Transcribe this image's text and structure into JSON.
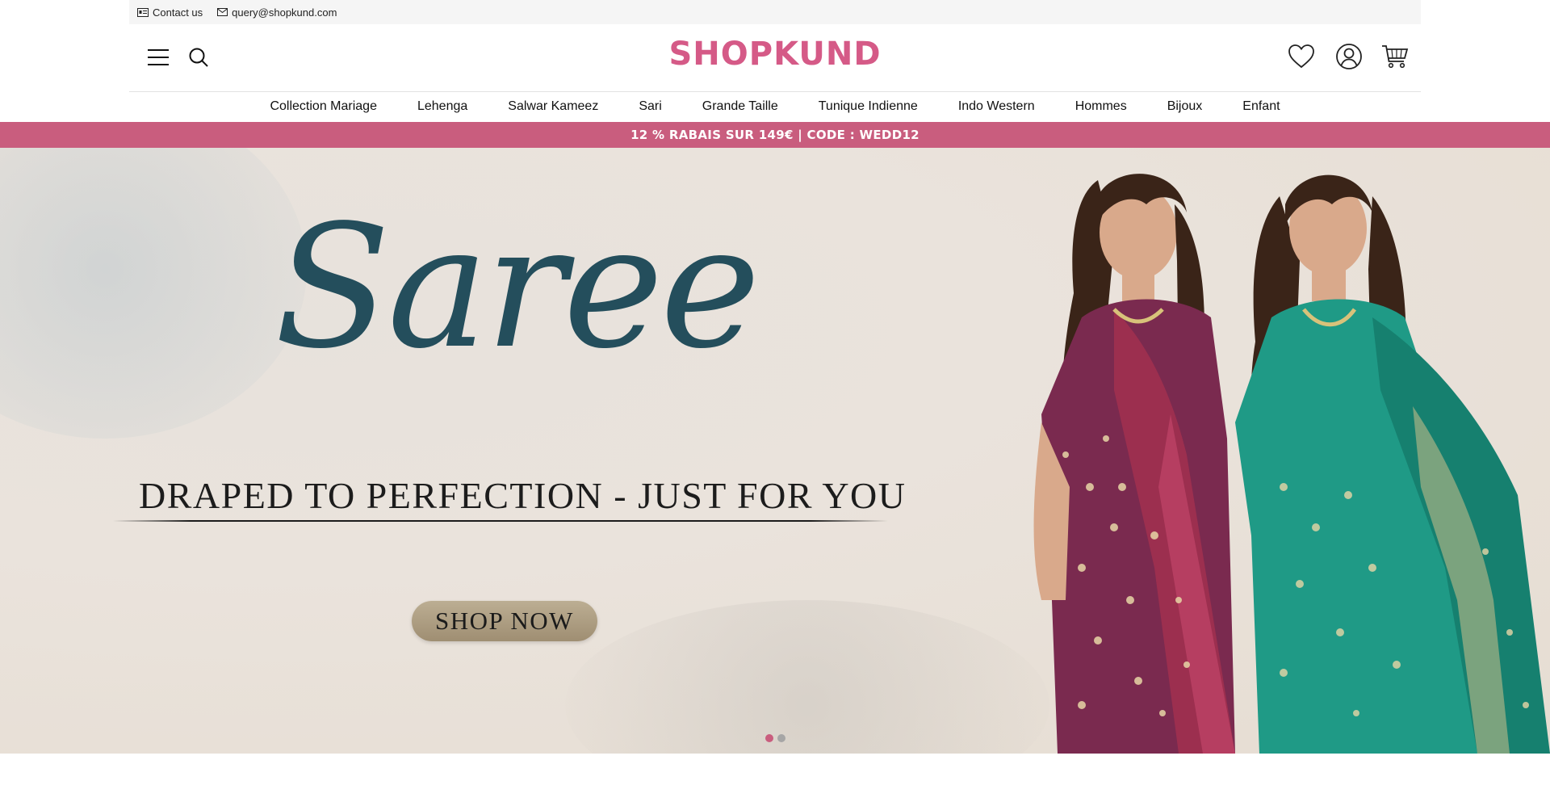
{
  "topbar": {
    "contact_label": "Contact us",
    "email": "query@shopkund.com",
    "contact_icon": "contact-card-icon",
    "email_icon": "envelope-icon"
  },
  "header": {
    "logo": "SHOPKUND",
    "menu_icon": "hamburger-menu-icon",
    "search_icon": "search-icon",
    "wishlist_icon": "heart-icon",
    "account_icon": "user-icon",
    "cart_icon": "cart-icon"
  },
  "nav": {
    "items": [
      {
        "label": "Collection Mariage"
      },
      {
        "label": "Lehenga"
      },
      {
        "label": "Salwar Kameez"
      },
      {
        "label": "Sari"
      },
      {
        "label": "Grande Taille"
      },
      {
        "label": "Tunique Indienne"
      },
      {
        "label": "Indo Western"
      },
      {
        "label": "Hommes"
      },
      {
        "label": "Bijoux"
      },
      {
        "label": "Enfant"
      }
    ]
  },
  "promo": {
    "text": "12 % RABAIS SUR 149€ | CODE : WEDD12"
  },
  "hero": {
    "title": "Saree",
    "tagline": "DRAPED TO PERFECTION - JUST FOR YOU",
    "cta": "SHOP NOW",
    "slides_total": 2,
    "active_slide": 1
  },
  "colors": {
    "brand": "#d55a87",
    "promo_bg": "#c95d7e",
    "title_teal": "#244e5c",
    "saree_left": "#7a2a4f",
    "saree_right": "#1f9a86"
  }
}
